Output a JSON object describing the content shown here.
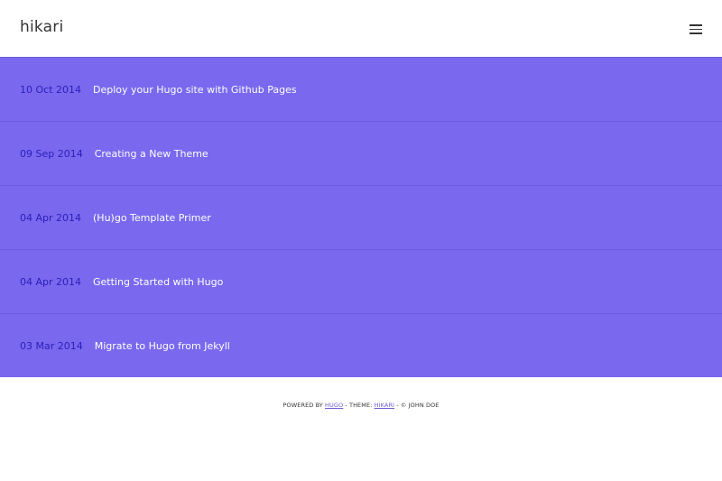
{
  "header": {
    "brand": "hikari",
    "menu_icon": "hamburger-menu-icon"
  },
  "posts": [
    {
      "date": "10 Oct 2014",
      "title": "Deploy your Hugo site with Github Pages"
    },
    {
      "date": "09 Sep 2014",
      "title": "Creating a New Theme"
    },
    {
      "date": "04 Apr 2014",
      "title": "(Hu)go Template Primer"
    },
    {
      "date": "04 Apr 2014",
      "title": "Getting Started with Hugo"
    },
    {
      "date": "03 Mar 2014",
      "title": "Migrate to Hugo from Jekyll"
    }
  ],
  "footer": {
    "powered_by": "POWERED BY",
    "hugo_link": "HUGO",
    "theme_sep": " - THEME: ",
    "theme_link": "HIKARI",
    "copyright": " - © JOHN DOE"
  },
  "colors": {
    "accent": "#7a68ef",
    "date": "#2b1fb8",
    "link": "#6a5cd8"
  }
}
